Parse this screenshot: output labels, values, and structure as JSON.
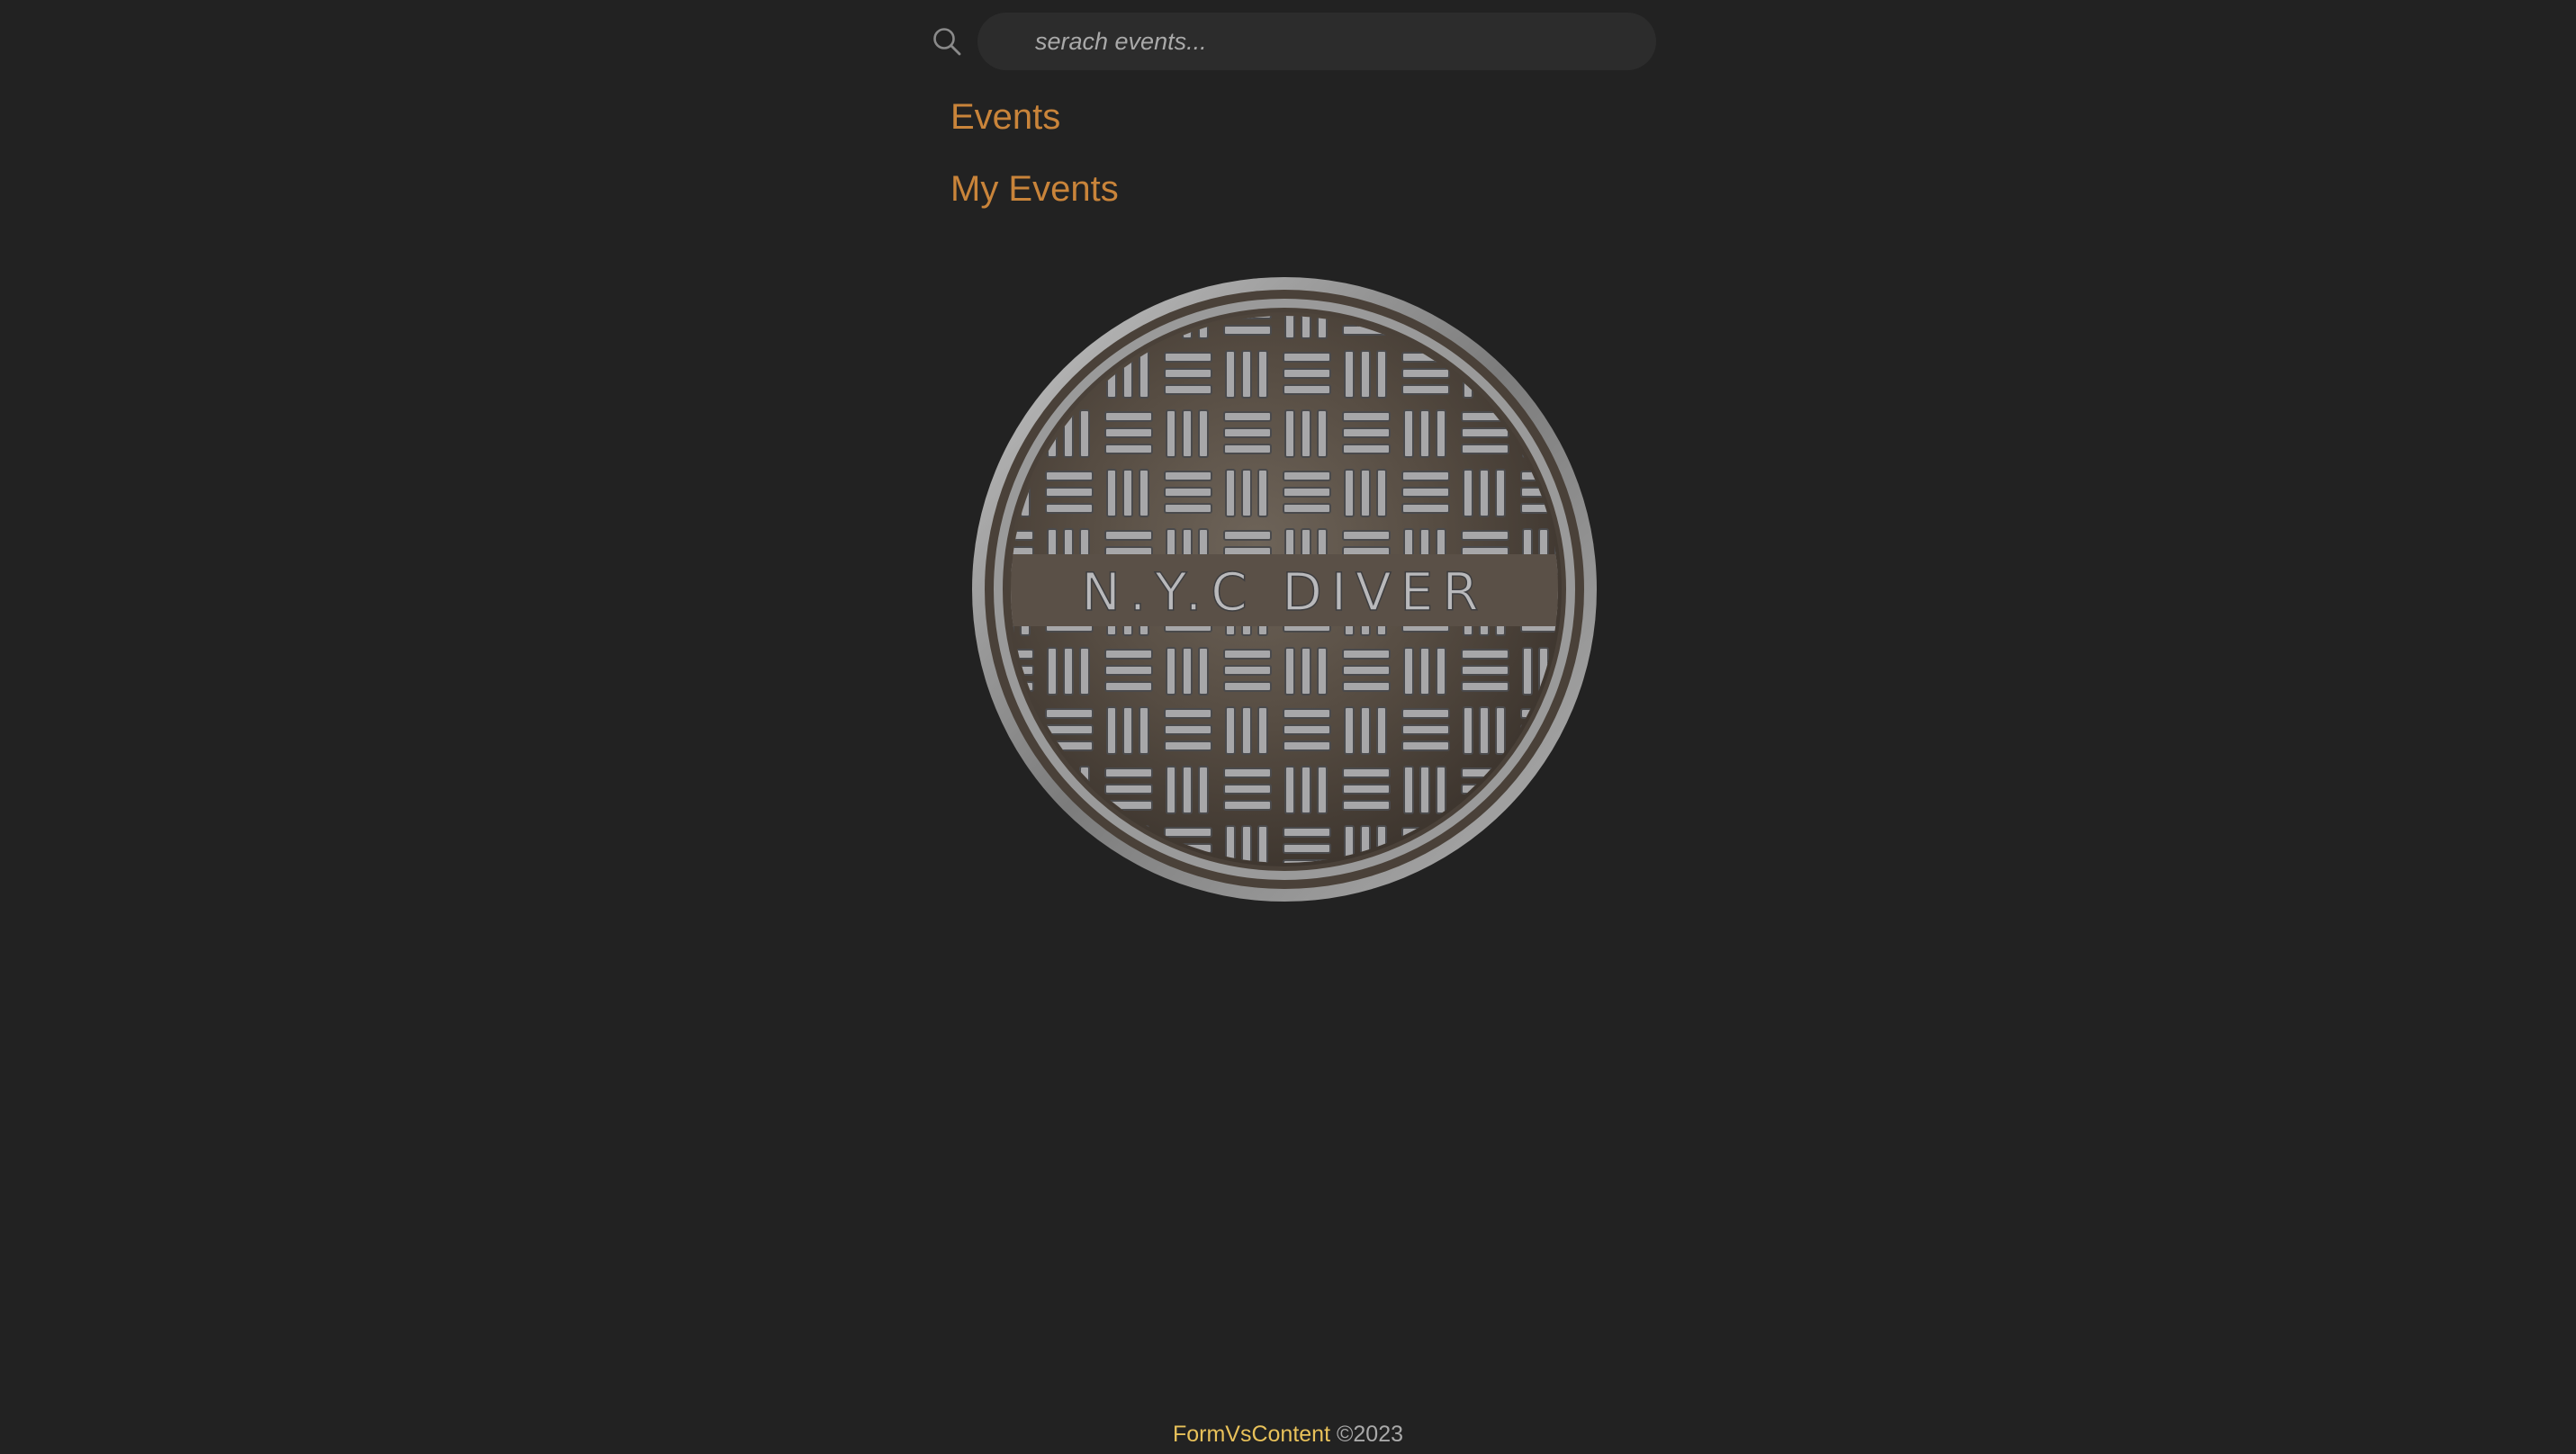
{
  "search": {
    "placeholder": "serach events...",
    "value": ""
  },
  "nav": {
    "items": [
      {
        "label": "Events"
      },
      {
        "label": "My Events"
      }
    ]
  },
  "hero": {
    "image": "nyc-sewer-manhole-cover",
    "cover_text": "N.Y.C DIVER"
  },
  "footer": {
    "brand": "FormVsContent",
    "copyright": "©2023"
  },
  "colors": {
    "background": "#222222",
    "link": "#c9843a",
    "brand": "#e8c15a",
    "muted": "#a9a9a9"
  },
  "icons": {
    "search": "search-icon"
  }
}
